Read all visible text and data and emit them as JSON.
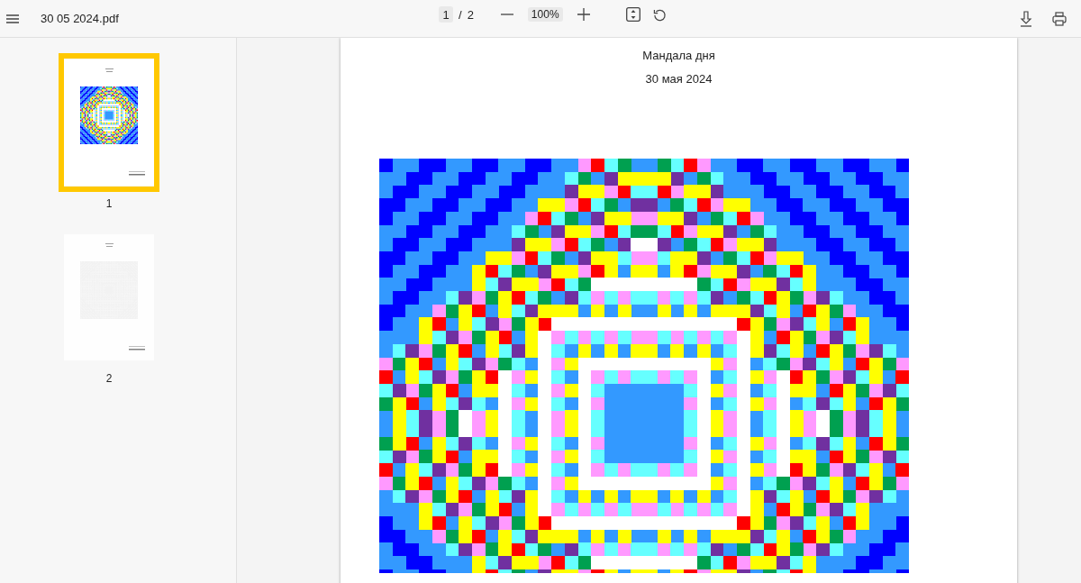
{
  "toolbar": {
    "file_name": "30 05 2024.pdf",
    "current_page": "1",
    "page_separator": "/",
    "page_total": "2",
    "zoom": "100%"
  },
  "sidebar": {
    "thumbnails": [
      {
        "label": "1",
        "selected": true,
        "faded": false
      },
      {
        "label": "2",
        "selected": false,
        "faded": true
      }
    ]
  },
  "document": {
    "title": "Мандала дня",
    "date": "30 мая 2024"
  }
}
